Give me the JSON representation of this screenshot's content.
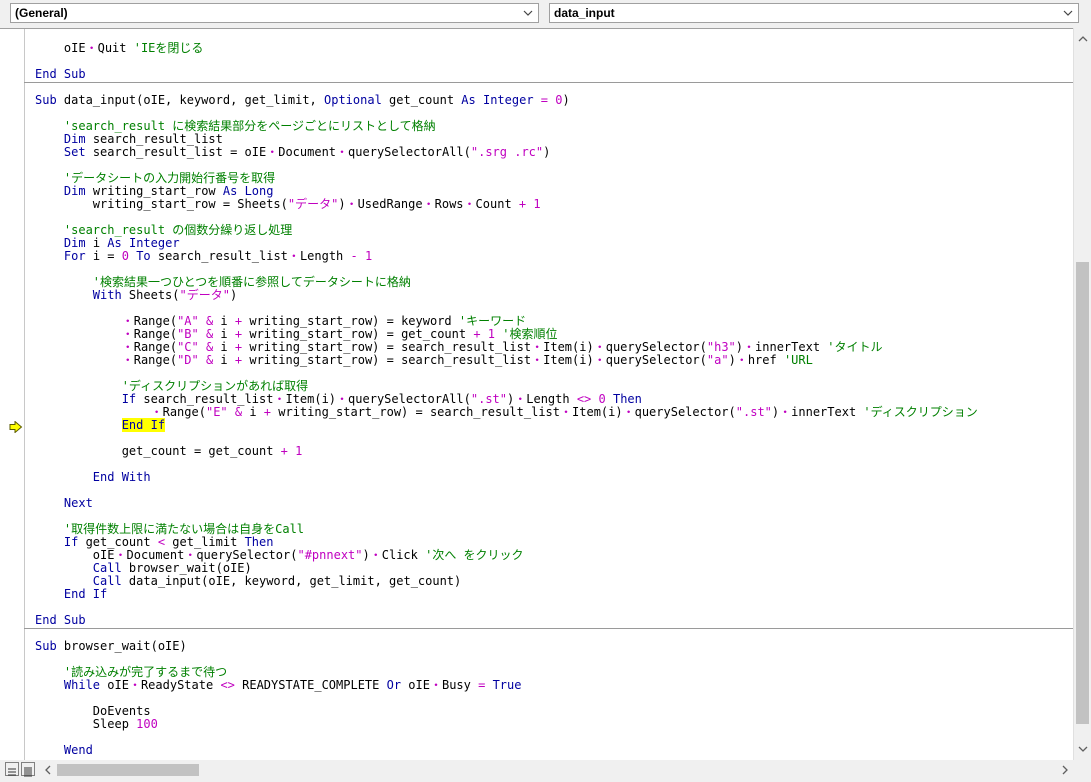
{
  "header": {
    "object_combo": "(General)",
    "proc_combo": "data_input"
  },
  "code_lines": [
    [
      [
        "    ",
        "n"
      ],
      [
        "oIE",
        "n"
      ],
      [
        "・",
        "ms"
      ],
      [
        "Quit ",
        "n"
      ],
      [
        "'IEを閉じる",
        "cm"
      ]
    ],
    [],
    [
      [
        "End Sub",
        "kw"
      ]
    ],
    [
      [
        "Sub",
        "kw"
      ],
      [
        " data_input(oIE, keyword, get_limit, ",
        "n"
      ],
      [
        "Optional",
        "kw"
      ],
      [
        " get_count ",
        "n"
      ],
      [
        "As",
        "kw"
      ],
      [
        " ",
        "n"
      ],
      [
        "Integer",
        "kw"
      ],
      [
        " ",
        "n"
      ],
      [
        "= 0",
        "ms"
      ],
      [
        ")",
        "n"
      ]
    ],
    [],
    [
      [
        "    ",
        "n"
      ],
      [
        "'search_result に検索結果部分をページごとにリストとして格納",
        "cm"
      ]
    ],
    [
      [
        "    ",
        "n"
      ],
      [
        "Dim",
        "kw"
      ],
      [
        " search_result_list",
        "n"
      ]
    ],
    [
      [
        "    ",
        "n"
      ],
      [
        "Set",
        "kw"
      ],
      [
        " search_result_list = oIE",
        "n"
      ],
      [
        "・",
        "ms"
      ],
      [
        "Document",
        "n"
      ],
      [
        "・",
        "ms"
      ],
      [
        "querySelectorAll(",
        "n"
      ],
      [
        "\".srg .rc\"",
        "ms"
      ],
      [
        ")",
        "n"
      ]
    ],
    [],
    [
      [
        "    ",
        "n"
      ],
      [
        "'データシートの入力開始行番号を取得",
        "cm"
      ]
    ],
    [
      [
        "    ",
        "n"
      ],
      [
        "Dim",
        "kw"
      ],
      [
        " writing_start_row ",
        "n"
      ],
      [
        "As",
        "kw"
      ],
      [
        " ",
        "n"
      ],
      [
        "Long",
        "kw"
      ]
    ],
    [
      [
        "        writing_start_row = Sheets(",
        "n"
      ],
      [
        "\"データ\"",
        "ms"
      ],
      [
        ")",
        "n"
      ],
      [
        "・",
        "ms"
      ],
      [
        "UsedRange",
        "n"
      ],
      [
        "・",
        "ms"
      ],
      [
        "Rows",
        "n"
      ],
      [
        "・",
        "ms"
      ],
      [
        "Count ",
        "n"
      ],
      [
        "+ 1",
        "ms"
      ]
    ],
    [],
    [
      [
        "    ",
        "n"
      ],
      [
        "'search_result の個数分繰り返し処理",
        "cm"
      ]
    ],
    [
      [
        "    ",
        "n"
      ],
      [
        "Dim",
        "kw"
      ],
      [
        " i ",
        "n"
      ],
      [
        "As",
        "kw"
      ],
      [
        " ",
        "n"
      ],
      [
        "Integer",
        "kw"
      ]
    ],
    [
      [
        "    ",
        "n"
      ],
      [
        "For",
        "kw"
      ],
      [
        " i = ",
        "n"
      ],
      [
        "0",
        "ms"
      ],
      [
        " ",
        "n"
      ],
      [
        "To",
        "kw"
      ],
      [
        " search_result_list",
        "n"
      ],
      [
        "・",
        "ms"
      ],
      [
        "Length ",
        "n"
      ],
      [
        "- 1",
        "ms"
      ]
    ],
    [],
    [
      [
        "        ",
        "n"
      ],
      [
        "'検索結果一つひとつを順番に参照してデータシートに格納",
        "cm"
      ]
    ],
    [
      [
        "        ",
        "n"
      ],
      [
        "With",
        "kw"
      ],
      [
        " Sheets(",
        "n"
      ],
      [
        "\"データ\"",
        "ms"
      ],
      [
        ")",
        "n"
      ]
    ],
    [],
    [
      [
        "            ",
        "n"
      ],
      [
        "・",
        "ms"
      ],
      [
        "Range(",
        "n"
      ],
      [
        "\"A\" &",
        "ms"
      ],
      [
        " i ",
        "n"
      ],
      [
        "+",
        "ms"
      ],
      [
        " writing_start_row) = keyword ",
        "n"
      ],
      [
        "'キーワード",
        "cm"
      ]
    ],
    [
      [
        "            ",
        "n"
      ],
      [
        "・",
        "ms"
      ],
      [
        "Range(",
        "n"
      ],
      [
        "\"B\" &",
        "ms"
      ],
      [
        " i ",
        "n"
      ],
      [
        "+",
        "ms"
      ],
      [
        " writing_start_row) = get_count ",
        "n"
      ],
      [
        "+ 1",
        "ms"
      ],
      [
        " ",
        "n"
      ],
      [
        "'検索順位",
        "cm"
      ]
    ],
    [
      [
        "            ",
        "n"
      ],
      [
        "・",
        "ms"
      ],
      [
        "Range(",
        "n"
      ],
      [
        "\"C\" &",
        "ms"
      ],
      [
        " i ",
        "n"
      ],
      [
        "+",
        "ms"
      ],
      [
        " writing_start_row) = search_result_list",
        "n"
      ],
      [
        "・",
        "ms"
      ],
      [
        "Item(i)",
        "n"
      ],
      [
        "・",
        "ms"
      ],
      [
        "querySelector(",
        "n"
      ],
      [
        "\"h3\"",
        "ms"
      ],
      [
        ")",
        "n"
      ],
      [
        "・",
        "ms"
      ],
      [
        "innerText ",
        "n"
      ],
      [
        "'タイトル",
        "cm"
      ]
    ],
    [
      [
        "            ",
        "n"
      ],
      [
        "・",
        "ms"
      ],
      [
        "Range(",
        "n"
      ],
      [
        "\"D\" &",
        "ms"
      ],
      [
        " i ",
        "n"
      ],
      [
        "+",
        "ms"
      ],
      [
        " writing_start_row) = search_result_list",
        "n"
      ],
      [
        "・",
        "ms"
      ],
      [
        "Item(i)",
        "n"
      ],
      [
        "・",
        "ms"
      ],
      [
        "querySelector(",
        "n"
      ],
      [
        "\"a\"",
        "ms"
      ],
      [
        ")",
        "n"
      ],
      [
        "・",
        "ms"
      ],
      [
        "href ",
        "n"
      ],
      [
        "'URL",
        "cm"
      ]
    ],
    [],
    [
      [
        "            ",
        "n"
      ],
      [
        "'ディスクリプションがあれば取得",
        "cm"
      ]
    ],
    [
      [
        "            ",
        "n"
      ],
      [
        "If",
        "kw"
      ],
      [
        " search_result_list",
        "n"
      ],
      [
        "・",
        "ms"
      ],
      [
        "Item(i)",
        "n"
      ],
      [
        "・",
        "ms"
      ],
      [
        "querySelectorAll(",
        "n"
      ],
      [
        "\".st\"",
        "ms"
      ],
      [
        ")",
        "n"
      ],
      [
        "・",
        "ms"
      ],
      [
        "Length ",
        "n"
      ],
      [
        "<> 0",
        "ms"
      ],
      [
        " ",
        "n"
      ],
      [
        "Then",
        "kw"
      ]
    ],
    [
      [
        "                ",
        "n"
      ],
      [
        "・",
        "ms"
      ],
      [
        "Range(",
        "n"
      ],
      [
        "\"E\" &",
        "ms"
      ],
      [
        " i ",
        "n"
      ],
      [
        "+",
        "ms"
      ],
      [
        " writing_start_row) = search_result_list",
        "n"
      ],
      [
        "・",
        "ms"
      ],
      [
        "Item(i)",
        "n"
      ],
      [
        "・",
        "ms"
      ],
      [
        "querySelector(",
        "n"
      ],
      [
        "\".st\"",
        "ms"
      ],
      [
        ")",
        "n"
      ],
      [
        "・",
        "ms"
      ],
      [
        "innerText ",
        "n"
      ],
      [
        "'ディスクリプション",
        "cm"
      ]
    ],
    [
      [
        "            ",
        "n"
      ],
      [
        "End If",
        "kwhl"
      ]
    ],
    [],
    [
      [
        "            get_count = get_count ",
        "n"
      ],
      [
        "+ 1",
        "ms"
      ]
    ],
    [],
    [
      [
        "        ",
        "n"
      ],
      [
        "End With",
        "kw"
      ]
    ],
    [],
    [
      [
        "    ",
        "n"
      ],
      [
        "Next",
        "kw"
      ]
    ],
    [],
    [
      [
        "    ",
        "n"
      ],
      [
        "'取得件数上限に満たない場合は自身をCall",
        "cm"
      ]
    ],
    [
      [
        "    ",
        "n"
      ],
      [
        "If",
        "kw"
      ],
      [
        " get_count ",
        "n"
      ],
      [
        "<",
        "ms"
      ],
      [
        " get_limit ",
        "n"
      ],
      [
        "Then",
        "kw"
      ]
    ],
    [
      [
        "        oIE",
        "n"
      ],
      [
        "・",
        "ms"
      ],
      [
        "Document",
        "n"
      ],
      [
        "・",
        "ms"
      ],
      [
        "querySelector(",
        "n"
      ],
      [
        "\"#pnnext\"",
        "ms"
      ],
      [
        ")",
        "n"
      ],
      [
        "・",
        "ms"
      ],
      [
        "Click ",
        "n"
      ],
      [
        "'次へ をクリック",
        "cm"
      ]
    ],
    [
      [
        "        ",
        "n"
      ],
      [
        "Call",
        "kw"
      ],
      [
        " browser_wait(oIE)",
        "n"
      ]
    ],
    [
      [
        "        ",
        "n"
      ],
      [
        "Call",
        "kw"
      ],
      [
        " data_input(oIE, keyword, get_limit, get_count)",
        "n"
      ]
    ],
    [
      [
        "    ",
        "n"
      ],
      [
        "End If",
        "kw"
      ]
    ],
    [],
    [
      [
        "End Sub",
        "kw"
      ]
    ],
    [
      [
        "Sub",
        "kw"
      ],
      [
        " browser_wait(oIE)",
        "n"
      ]
    ],
    [],
    [
      [
        "    ",
        "n"
      ],
      [
        "'読み込みが完了するまで待つ",
        "cm"
      ]
    ],
    [
      [
        "    ",
        "n"
      ],
      [
        "While",
        "kw"
      ],
      [
        " oIE",
        "n"
      ],
      [
        "・",
        "ms"
      ],
      [
        "ReadyState ",
        "n"
      ],
      [
        "<>",
        "ms"
      ],
      [
        " READYSTATE_COMPLETE ",
        "n"
      ],
      [
        "Or",
        "kw"
      ],
      [
        " oIE",
        "n"
      ],
      [
        "・",
        "ms"
      ],
      [
        "Busy ",
        "n"
      ],
      [
        "=",
        "ms"
      ],
      [
        " ",
        "n"
      ],
      [
        "True",
        "kw"
      ]
    ],
    [],
    [
      [
        "        DoEvents",
        "n"
      ]
    ],
    [
      [
        "        Sleep ",
        "n"
      ],
      [
        "100",
        "ms"
      ]
    ],
    [],
    [
      [
        "    ",
        "n"
      ],
      [
        "Wend",
        "kw"
      ]
    ]
  ],
  "colors": {
    "keyword": "#0000a0",
    "comment": "#008000",
    "operator": "#c000c0",
    "highlight": "#ffff00",
    "arrow": "#ffff00"
  }
}
